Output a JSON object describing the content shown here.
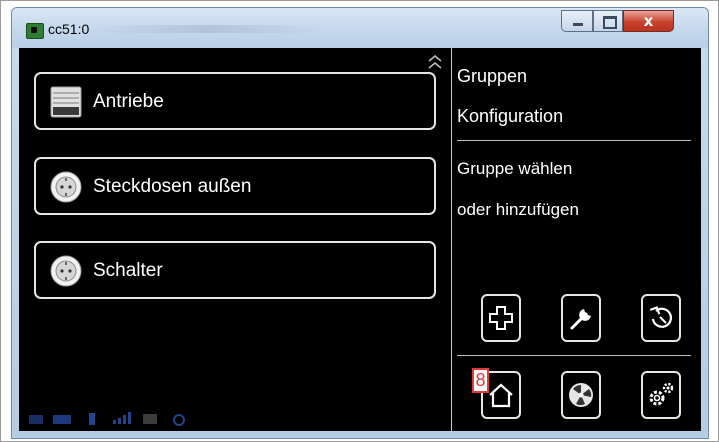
{
  "window": {
    "title": "cc51:0",
    "close_label": "x"
  },
  "groups": [
    {
      "label": "Antriebe",
      "icon": "blind-icon"
    },
    {
      "label": "Steckdosen außen",
      "icon": "socket-icon"
    },
    {
      "label": "Schalter",
      "icon": "socket-icon"
    }
  ],
  "panel": {
    "title_line1": "Gruppen",
    "title_line2": "Konfiguration",
    "hint_line1": "Gruppe wählen",
    "hint_line2": "oder hinzufügen"
  },
  "actions": [
    {
      "name": "add-icon"
    },
    {
      "name": "wrench-icon"
    },
    {
      "name": "back-icon"
    },
    {
      "name": "home-icon"
    },
    {
      "name": "fan-icon"
    },
    {
      "name": "gears-icon"
    }
  ],
  "badge": {
    "value": "8",
    "color": "#e53935"
  },
  "colors": {
    "screen_bg": "#000000",
    "outline": "#e6e6e6",
    "text": "#ffffff"
  }
}
